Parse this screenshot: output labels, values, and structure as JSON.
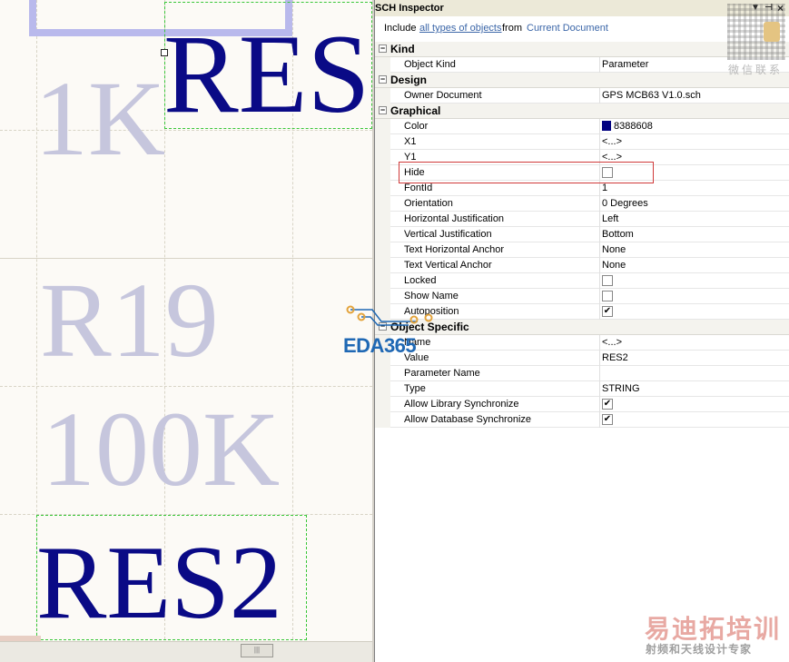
{
  "canvas": {
    "texts": {
      "res_top": "RES",
      "k1": "1K",
      "r19": "R19",
      "k100": "100K",
      "res2": "RES2"
    },
    "colors": {
      "strong_text": "#0a0a86",
      "dim_text": "#c6c6dd",
      "selection": "#38c738",
      "background": "#fcfaf6"
    }
  },
  "panel": {
    "title": "SCH Inspector",
    "controls": {
      "menu": "▼",
      "pin": "⊣",
      "close": "×"
    },
    "filter": {
      "include_label": "Include",
      "types_link": "all types of objects",
      "from_label": "from",
      "source_link": "Current Document"
    },
    "categories": {
      "kind": {
        "label": "Kind",
        "props": [
          {
            "name": "Object Kind",
            "value": "Parameter"
          }
        ]
      },
      "design": {
        "label": "Design",
        "props": [
          {
            "name": "Owner Document",
            "value": "GPS MCB63 V1.0.sch"
          }
        ]
      },
      "graphical": {
        "label": "Graphical",
        "props": [
          {
            "name": "Color",
            "value": "8388608"
          },
          {
            "name": "X1",
            "value": "<...>"
          },
          {
            "name": "Y1",
            "value": "<...>"
          },
          {
            "name": "Hide",
            "value": ""
          },
          {
            "name": "FontId",
            "value": "1"
          },
          {
            "name": "Orientation",
            "value": "0 Degrees"
          },
          {
            "name": "Horizontal Justification",
            "value": "Left"
          },
          {
            "name": "Vertical Justification",
            "value": "Bottom"
          },
          {
            "name": "Text Horizontal Anchor",
            "value": "None"
          },
          {
            "name": "Text Vertical Anchor",
            "value": "None"
          },
          {
            "name": "Locked",
            "value": ""
          },
          {
            "name": "Show Name",
            "value": ""
          },
          {
            "name": "Autoposition",
            "value": ""
          }
        ]
      },
      "object_specific": {
        "label": "Object Specific",
        "props": [
          {
            "name": "Name",
            "value": "<...>"
          },
          {
            "name": "Value",
            "value": "RES2"
          },
          {
            "name": "Parameter Name",
            "value": ""
          },
          {
            "name": "Type",
            "value": "STRING"
          },
          {
            "name": "Allow Library Synchronize",
            "value": ""
          },
          {
            "name": "Allow Database Synchronize",
            "value": ""
          }
        ]
      }
    },
    "checkboxes": {
      "hide": false,
      "locked": false,
      "show_name": false,
      "autoposition": true,
      "allow_library_sync": true,
      "allow_database_sync": true
    },
    "checkmark_glyph": "✔",
    "color_swatch": "#000080",
    "highlight_color": "#d03a3a"
  },
  "watermarks": {
    "qr_caption": "微信联系",
    "eda_logo": "EDA365",
    "cn_brand": "易迪拓培训",
    "cn_tagline": "射频和天线设计专家"
  }
}
